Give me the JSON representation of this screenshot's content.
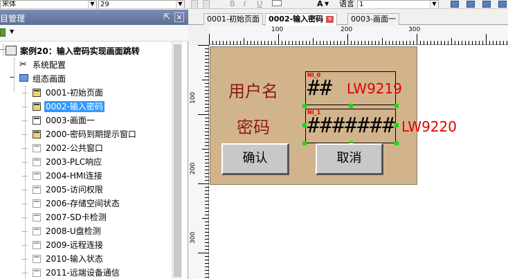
{
  "toolbar": {
    "font_name": "宋体",
    "font_size": "29",
    "bold": "B",
    "italic": "I",
    "underline": "U",
    "font_color_glyph": "A",
    "language_label": "语言",
    "language_value": "1"
  },
  "panel": {
    "title": "目管理",
    "pin_glyph": "⇱",
    "close_glyph": "✕"
  },
  "tree": {
    "root": "案例20：输入密码实现画面跳转",
    "system_config": "系统配置",
    "screens_group": "组态画面",
    "screens": [
      {
        "label": "0001-初始页面"
      },
      {
        "label": "0002-输入密码"
      },
      {
        "label": "0003-画面一"
      },
      {
        "label": "2000-密码到期提示窗口"
      },
      {
        "label": "2002-公共窗口"
      },
      {
        "label": "2003-PLC响应"
      },
      {
        "label": "2004-HMI连接"
      },
      {
        "label": "2005-访问权限"
      },
      {
        "label": "2006-存储空间状态"
      },
      {
        "label": "2007-SD卡检测"
      },
      {
        "label": "2008-U盘检测"
      },
      {
        "label": "2009-远程连接"
      },
      {
        "label": "2010-输入状态"
      },
      {
        "label": "2011-远端设备通信"
      }
    ],
    "selected_index": 1
  },
  "tabs": [
    {
      "label": "0001-初始页面"
    },
    {
      "label": "0002-输入密码"
    },
    {
      "label": "0003-画面一"
    }
  ],
  "ruler": {
    "top": [
      "100",
      "200",
      "300"
    ],
    "left": [
      "100",
      "200",
      "300"
    ]
  },
  "canvas": {
    "username_label": "用户名",
    "password_label": "密码",
    "username_input": {
      "id": "NI_0",
      "value": "##",
      "address": "LW9219"
    },
    "password_input": {
      "id": "NI_1",
      "value": "#######",
      "address": "LW9220"
    },
    "confirm_button": {
      "id": "FK_2",
      "label": "确认"
    },
    "cancel_button": {
      "id": "FK_1",
      "label": "取消"
    },
    "colors": {
      "screen_bg": "#d2b48c",
      "label_text": "#8b1a1a",
      "address_text": "#e00000",
      "selection_handle": "#10e010"
    }
  }
}
